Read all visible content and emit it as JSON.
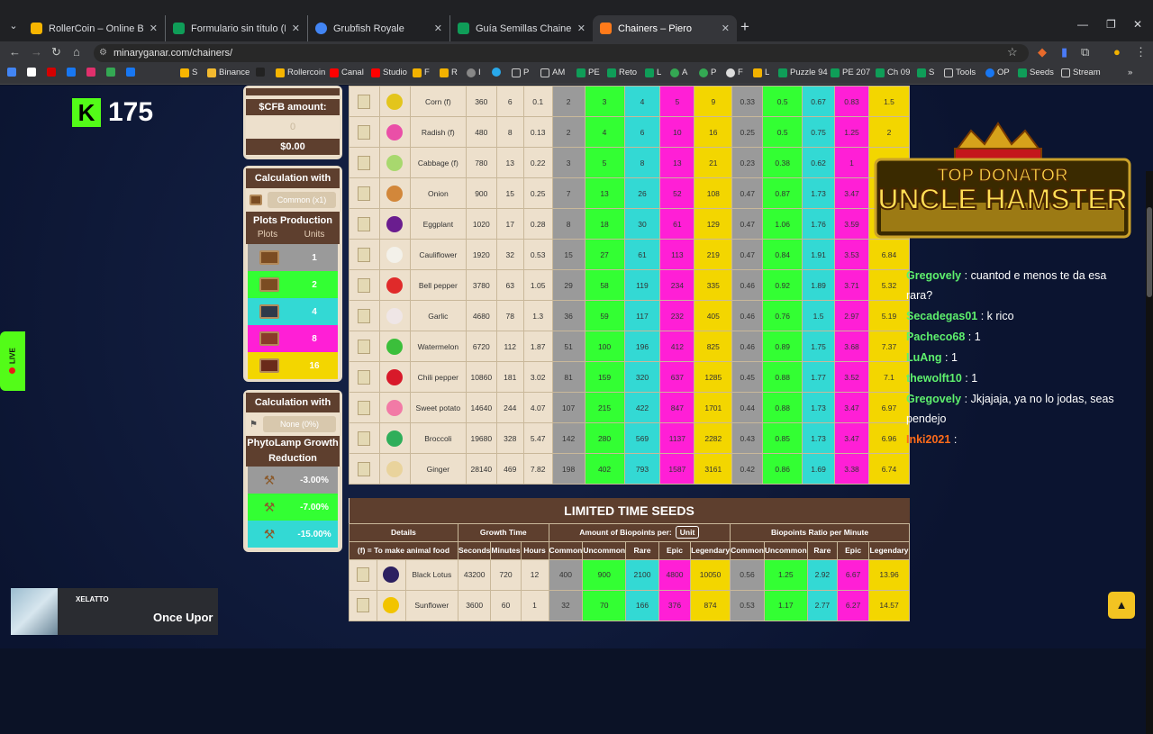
{
  "browser": {
    "tabs": [
      {
        "title": "RollerCoin – Online Bitcoin Min",
        "color": "#f7b500"
      },
      {
        "title": "Formulario sin título (Respuest",
        "color": "#0f9d58"
      },
      {
        "title": "Grubfish Royale",
        "color": "#4285f4"
      },
      {
        "title": "Guía Semillas Chainers by Piero",
        "color": "#0f9d58"
      },
      {
        "title": "Chainers – Piero",
        "color": "#ff7a1a"
      }
    ],
    "url": "minaryganar.com/chainers/",
    "bookmarks": [
      "",
      "",
      "",
      "",
      "",
      "",
      "",
      "S",
      "Binance",
      "",
      "Rollercoin",
      "Canal",
      "Studio",
      "F",
      "R",
      "I",
      "",
      "P",
      "AM",
      "PE",
      "Reto",
      "L",
      "A",
      "P",
      "F",
      "L",
      "Puzzle 94",
      "PE 207",
      "Ch 09",
      "S",
      "Tools",
      "OP",
      "Seeds",
      "Stream"
    ]
  },
  "kick": {
    "logo": "K",
    "count": "175"
  },
  "live_label": "LIVE",
  "left": {
    "cfb": {
      "label": "$CFB amount:",
      "value": "0",
      "usd": "$0.00"
    },
    "plot": {
      "title": "Calculation with Plot",
      "select": "Common (x1)",
      "prod_title": "Plots Production",
      "col_plots": "Plots",
      "col_units": "Units",
      "rows": [
        {
          "units": "1",
          "color": "#9a9a9a"
        },
        {
          "units": "2",
          "color": "#33ff33"
        },
        {
          "units": "4",
          "color": "#33d9d4"
        },
        {
          "units": "8",
          "color": "#ff1fd6"
        },
        {
          "units": "16",
          "color": "#f3d600"
        }
      ]
    },
    "lamp": {
      "title": "Calculation with Lamp",
      "select": "None (0%)",
      "growth_title": "PhytoLamp Growth Reduction",
      "rows": [
        {
          "value": "-3.00%",
          "color": "#9a9a9a"
        },
        {
          "value": "-7.00%",
          "color": "#33ff33"
        },
        {
          "value": "-15.00%",
          "color": "#33d9d4"
        }
      ]
    }
  },
  "seeds": [
    {
      "name": "Corn (f)",
      "crop_color": "#e3c51c",
      "s": "360",
      "m": "6",
      "h": "0.1",
      "c": "2",
      "u": "3",
      "r": "4",
      "e": "5",
      "l": "9",
      "rc": "0.33",
      "ru": "0.5",
      "rr": "0.67",
      "re": "0.83",
      "rl": "1.5"
    },
    {
      "name": "Radish (f)",
      "crop_color": "#ea4fa7",
      "s": "480",
      "m": "8",
      "h": "0.13",
      "c": "2",
      "u": "4",
      "r": "6",
      "e": "10",
      "l": "16",
      "rc": "0.25",
      "ru": "0.5",
      "rr": "0.75",
      "re": "1.25",
      "rl": "2"
    },
    {
      "name": "Cabbage (f)",
      "crop_color": "#a8d86e",
      "s": "780",
      "m": "13",
      "h": "0.22",
      "c": "3",
      "u": "5",
      "r": "8",
      "e": "13",
      "l": "21",
      "rc": "0.23",
      "ru": "0.38",
      "rr": "0.62",
      "re": "1",
      "rl": ""
    },
    {
      "name": "Onion",
      "crop_color": "#d2873a",
      "s": "900",
      "m": "15",
      "h": "0.25",
      "c": "7",
      "u": "13",
      "r": "26",
      "e": "52",
      "l": "108",
      "rc": "0.47",
      "ru": "0.87",
      "rr": "1.73",
      "re": "3.47",
      "rl": ""
    },
    {
      "name": "Eggplant",
      "crop_color": "#6a1d8f",
      "s": "1020",
      "m": "17",
      "h": "0.28",
      "c": "8",
      "u": "18",
      "r": "30",
      "e": "61",
      "l": "129",
      "rc": "0.47",
      "ru": "1.06",
      "rr": "1.76",
      "re": "3.59",
      "rl": ""
    },
    {
      "name": "Cauliflower",
      "crop_color": "#f3f1ea",
      "s": "1920",
      "m": "32",
      "h": "0.53",
      "c": "15",
      "u": "27",
      "r": "61",
      "e": "113",
      "l": "219",
      "rc": "0.47",
      "ru": "0.84",
      "rr": "1.91",
      "re": "3.53",
      "rl": "6.84"
    },
    {
      "name": "Bell pepper",
      "crop_color": "#e02a2a",
      "s": "3780",
      "m": "63",
      "h": "1.05",
      "c": "29",
      "u": "58",
      "r": "119",
      "e": "234",
      "l": "335",
      "rc": "0.46",
      "ru": "0.92",
      "rr": "1.89",
      "re": "3.71",
      "rl": "5.32"
    },
    {
      "name": "Garlic",
      "crop_color": "#efe6e6",
      "s": "4680",
      "m": "78",
      "h": "1.3",
      "c": "36",
      "u": "59",
      "r": "117",
      "e": "232",
      "l": "405",
      "rc": "0.46",
      "ru": "0.76",
      "rr": "1.5",
      "re": "2.97",
      "rl": "5.19"
    },
    {
      "name": "Watermelon",
      "crop_color": "#3bbf3b",
      "s": "6720",
      "m": "112",
      "h": "1.87",
      "c": "51",
      "u": "100",
      "r": "196",
      "e": "412",
      "l": "825",
      "rc": "0.46",
      "ru": "0.89",
      "rr": "1.75",
      "re": "3.68",
      "rl": "7.37"
    },
    {
      "name": "Chili pepper",
      "crop_color": "#d8192a",
      "s": "10860",
      "m": "181",
      "h": "3.02",
      "c": "81",
      "u": "159",
      "r": "320",
      "e": "637",
      "l": "1285",
      "rc": "0.45",
      "ru": "0.88",
      "rr": "1.77",
      "re": "3.52",
      "rl": "7.1"
    },
    {
      "name": "Sweet potato",
      "crop_color": "#f27aa6",
      "s": "14640",
      "m": "244",
      "h": "4.07",
      "c": "107",
      "u": "215",
      "r": "422",
      "e": "847",
      "l": "1701",
      "rc": "0.44",
      "ru": "0.88",
      "rr": "1.73",
      "re": "3.47",
      "rl": "6.97"
    },
    {
      "name": "Broccoli",
      "crop_color": "#2fae5a",
      "s": "19680",
      "m": "328",
      "h": "5.47",
      "c": "142",
      "u": "280",
      "r": "569",
      "e": "1137",
      "l": "2282",
      "rc": "0.43",
      "ru": "0.85",
      "rr": "1.73",
      "re": "3.47",
      "rl": "6.96"
    },
    {
      "name": "Ginger",
      "crop_color": "#e9d39c",
      "s": "28140",
      "m": "469",
      "h": "7.82",
      "c": "198",
      "u": "402",
      "r": "793",
      "e": "1587",
      "l": "3161",
      "rc": "0.42",
      "ru": "0.86",
      "rr": "1.69",
      "re": "3.38",
      "rl": "6.74"
    }
  ],
  "limited": {
    "title": "LIMITED TIME SEEDS",
    "details": "Details",
    "details_note": "(f) = To make animal food",
    "growth": "Growth Time",
    "amount": "Amount of Biopoints per:",
    "unit_btn": "Unit",
    "ratio": "Biopoints Ratio per Minute",
    "subheads": [
      "Seconds",
      "Minutes",
      "Hours",
      "Common",
      "Uncommon",
      "Rare",
      "Epic",
      "Legendary",
      "Common",
      "Uncommon",
      "Rare",
      "Epic",
      "Legendary"
    ],
    "rows": [
      {
        "name": "Black Lotus",
        "crop_color": "#2c2060",
        "s": "43200",
        "m": "720",
        "h": "12",
        "c": "400",
        "u": "900",
        "r": "2100",
        "e": "4800",
        "l": "10050",
        "rc": "0.56",
        "ru": "1.25",
        "rr": "2.92",
        "re": "6.67",
        "rl": "13.96"
      },
      {
        "name": "Sunflower",
        "crop_color": "#f2c400",
        "s": "3600",
        "m": "60",
        "h": "1",
        "c": "32",
        "u": "70",
        "r": "166",
        "e": "376",
        "l": "874",
        "rc": "0.53",
        "ru": "1.17",
        "rr": "2.77",
        "re": "6.27",
        "rl": "14.57"
      }
    ]
  },
  "banner": {
    "line1": "TOP DONATOR",
    "line2": "UNCLE HAMSTER"
  },
  "chat": [
    {
      "user": "Gregovely",
      "color": "#5ef06d",
      "text": "cuantod e menos te da esa rara?"
    },
    {
      "user": "Secadegas01",
      "color": "#5ef06d",
      "text": "k rico"
    },
    {
      "user": "Pacheco68",
      "color": "#5ef06d",
      "text": "1"
    },
    {
      "user": "LuAng",
      "color": "#5ef06d",
      "text": "1"
    },
    {
      "user": "thewolft10",
      "color": "#5ef06d",
      "text": "1"
    },
    {
      "user": "Gregovely",
      "color": "#5ef06d",
      "text": "Jkjajaja, ya no lo jodas, seas pendejo"
    },
    {
      "user": "Inki2021",
      "color": "#ff6b1a",
      "text": ""
    }
  ],
  "streamer": {
    "name": "XELATTO",
    "subtitle": "Once Upor"
  }
}
